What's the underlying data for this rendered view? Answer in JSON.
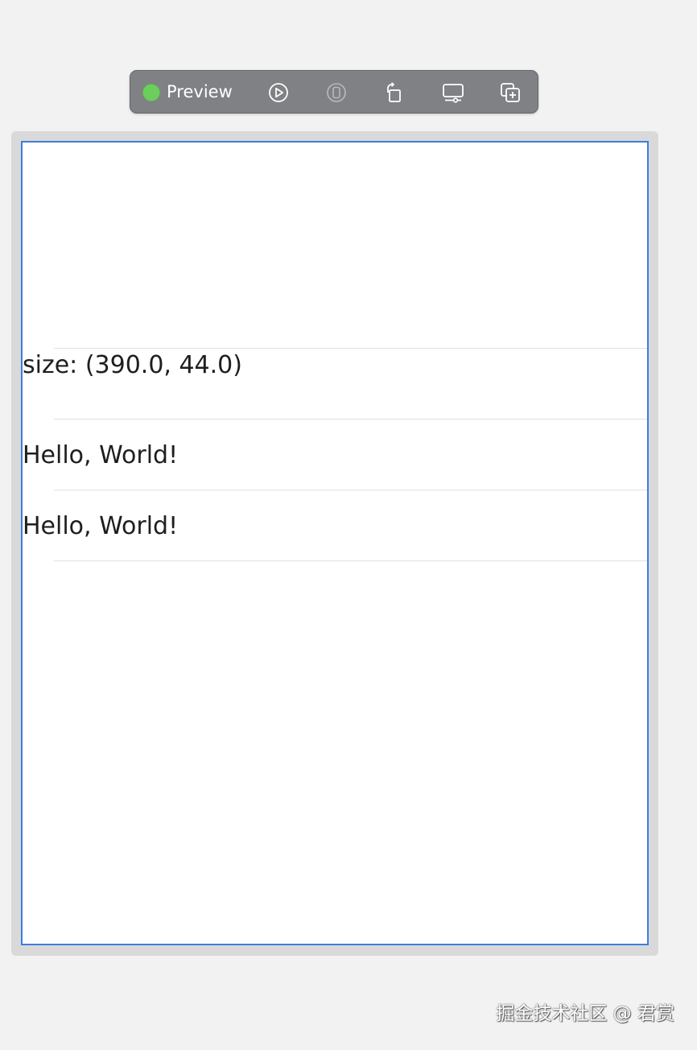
{
  "toolbar": {
    "status_color": "#6ccf5d",
    "preview_label": "Preview",
    "buttons": [
      {
        "icon": "live-play-icon",
        "enabled": true
      },
      {
        "icon": "device-inspect-icon",
        "enabled": false
      },
      {
        "icon": "rotate-device-icon",
        "enabled": true
      },
      {
        "icon": "device-settings-icon",
        "enabled": true
      },
      {
        "icon": "duplicate-preview-icon",
        "enabled": true
      }
    ]
  },
  "canvas": {
    "frame_color": "#d9d9d9",
    "selection_color": "#3d7edb",
    "rows": [
      {
        "text": "size: (390.0, 44.0)"
      },
      {
        "text": "Hello, World!"
      },
      {
        "text": "Hello, World!"
      }
    ]
  },
  "watermark": {
    "text": "掘金技术社区 @ 君赏"
  }
}
